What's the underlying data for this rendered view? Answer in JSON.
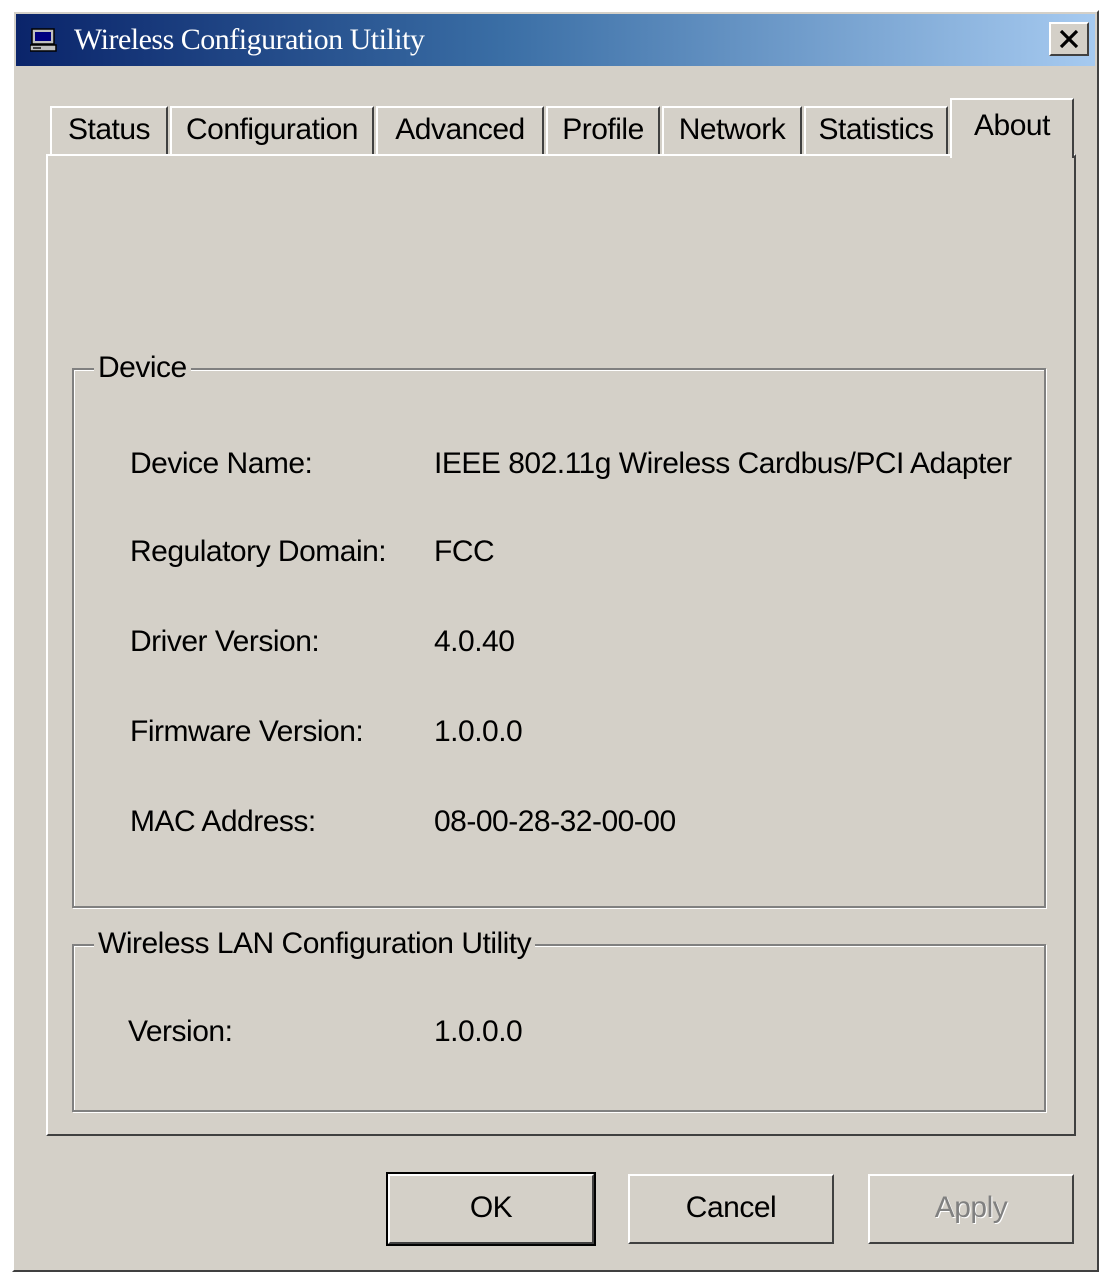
{
  "window": {
    "title": "Wireless Configuration Utility",
    "close_label": "×"
  },
  "tabs": [
    {
      "label": "Status",
      "active": false
    },
    {
      "label": "Configuration",
      "active": false
    },
    {
      "label": "Advanced",
      "active": false
    },
    {
      "label": "Profile",
      "active": false
    },
    {
      "label": "Network",
      "active": false
    },
    {
      "label": "Statistics",
      "active": false
    },
    {
      "label": "About",
      "active": true
    }
  ],
  "device": {
    "title": "Device",
    "rows": [
      {
        "label": "Device Name:",
        "value": "IEEE 802.11g Wireless Cardbus/PCI Adapter"
      },
      {
        "label": "Regulatory Domain:",
        "value": "FCC"
      },
      {
        "label": "Driver Version:",
        "value": "4.0.40"
      },
      {
        "label": "Firmware Version:",
        "value": "1.0.0.0"
      },
      {
        "label": "MAC Address:",
        "value": "08-00-28-32-00-00"
      }
    ]
  },
  "utility": {
    "title": "Wireless LAN Configuration Utility",
    "rows": [
      {
        "label": "Version:",
        "value": "1.0.0.0"
      }
    ]
  },
  "buttons": {
    "ok": "OK",
    "cancel": "Cancel",
    "apply": "Apply"
  },
  "colors": {
    "titlebar_start": "#0a246a",
    "titlebar_end": "#a6caf0",
    "face": "#d4d0c8",
    "disabled_text": "#808080"
  },
  "icons": {
    "app": "computer-monitor-icon",
    "close": "close-icon"
  }
}
